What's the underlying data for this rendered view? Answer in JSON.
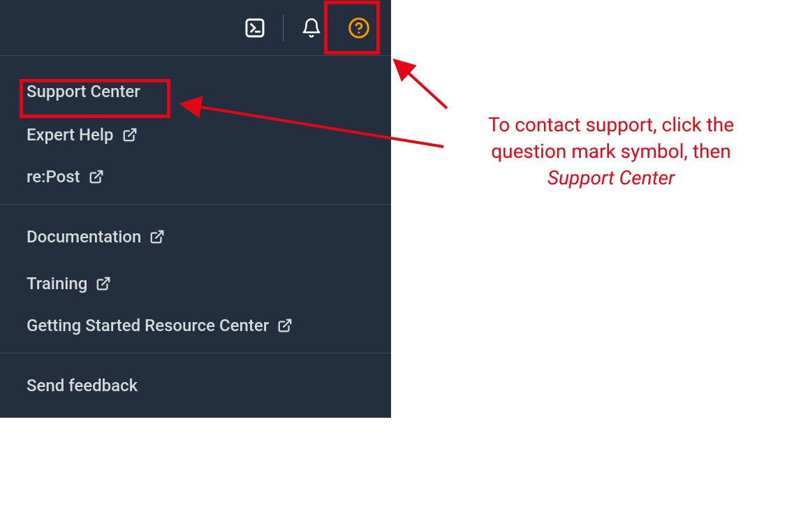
{
  "menu": {
    "section1": [
      {
        "label": "Support Center",
        "external": false
      },
      {
        "label": "Expert Help",
        "external": true
      },
      {
        "label": "re:Post",
        "external": true
      }
    ],
    "section2": [
      {
        "label": "Documentation",
        "external": true
      },
      {
        "label": "Training",
        "external": true
      },
      {
        "label": "Getting Started Resource Center",
        "external": true
      }
    ],
    "section3": [
      {
        "label": "Send feedback",
        "external": false
      }
    ]
  },
  "annotation": {
    "line1": "To contact support, click the",
    "line2": "question mark symbol, then",
    "line3_italic": "Support Center"
  },
  "colors": {
    "panel_bg": "#232f3e",
    "highlight": "#e30613",
    "help_icon": "#ff9900"
  }
}
